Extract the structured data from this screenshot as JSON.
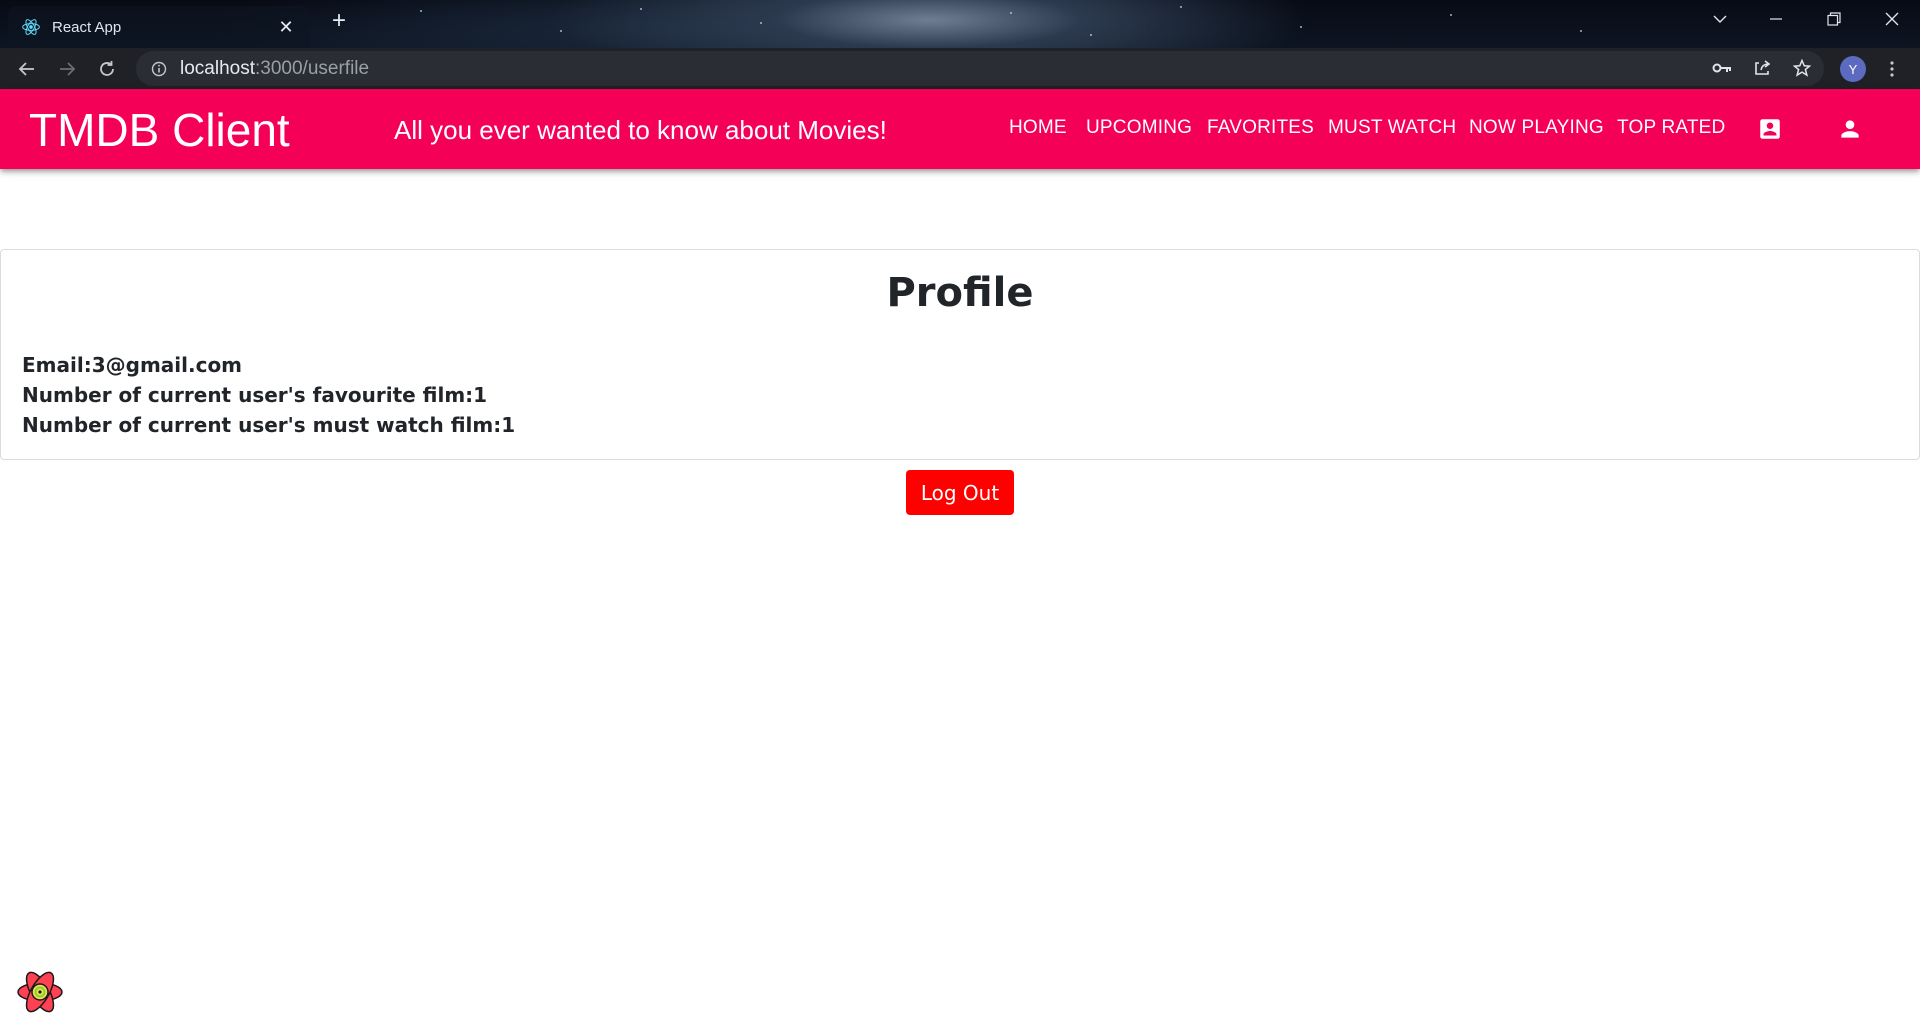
{
  "browser": {
    "tab_title": "React App",
    "url_host": "localhost",
    "url_path": ":3000/userfile",
    "profile_initial": "Y"
  },
  "appbar": {
    "brand": "TMDB Client",
    "tagline": "All you ever wanted to know about Movies!",
    "nav": [
      "HOME",
      "UPCOMING",
      "FAVORITES",
      "MUST WATCH",
      "NOW PLAYING",
      "TOP RATED"
    ],
    "icons": [
      "account-box-icon",
      "person-icon"
    ],
    "color": "#f50057"
  },
  "profile": {
    "title": "Profile",
    "email_line": "Email:3@gmail.com",
    "favourite_line": "Number of current user's favourite film:1",
    "must_watch_line": "Number of current user's must watch film:1"
  },
  "logout": {
    "label": "Log Out",
    "color": "#ff0000"
  }
}
